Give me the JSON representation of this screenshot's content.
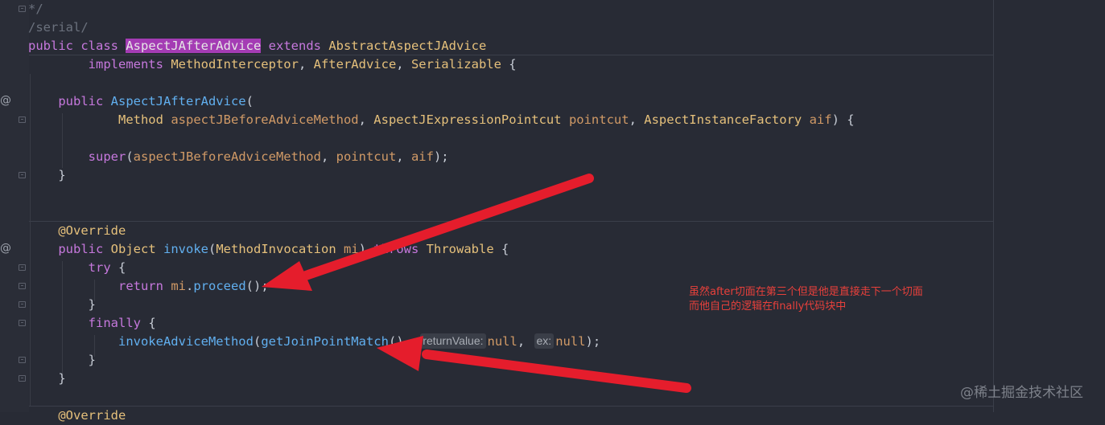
{
  "editor": {
    "lines": [
      {
        "tokens": [
          {
            "t": "*/",
            "c": "cm"
          }
        ]
      },
      {
        "tokens": [
          {
            "t": "/serial/",
            "c": "cm"
          }
        ]
      },
      {
        "tokens": [
          {
            "t": "public class ",
            "c": "kw"
          },
          {
            "t": "AspectJAfterAdvice",
            "c": "hl"
          },
          {
            "t": " "
          },
          {
            "t": "extends ",
            "c": "kw"
          },
          {
            "t": "AbstractAspectJAdvice",
            "c": "ty"
          }
        ]
      },
      {
        "tokens": [
          {
            "t": "        "
          },
          {
            "t": "implements ",
            "c": "kw"
          },
          {
            "t": "MethodInterceptor",
            "c": "ty"
          },
          {
            "t": ", "
          },
          {
            "t": "AfterAdvice",
            "c": "ty"
          },
          {
            "t": ", "
          },
          {
            "t": "Serializable",
            "c": "ty"
          },
          {
            "t": " {"
          }
        ]
      },
      {
        "tokens": []
      },
      {
        "tokens": [
          {
            "t": "    "
          },
          {
            "t": "public ",
            "c": "kw"
          },
          {
            "t": "AspectJAfterAdvice",
            "c": "fn"
          },
          {
            "t": "("
          }
        ]
      },
      {
        "tokens": [
          {
            "t": "            "
          },
          {
            "t": "Method",
            "c": "ty"
          },
          {
            "t": " "
          },
          {
            "t": "aspectJBeforeAdviceMethod",
            "c": "pr"
          },
          {
            "t": ", "
          },
          {
            "t": "AspectJExpressionPointcut",
            "c": "ty"
          },
          {
            "t": " "
          },
          {
            "t": "pointcut",
            "c": "pr"
          },
          {
            "t": ", "
          },
          {
            "t": "AspectInstanceFactory",
            "c": "ty"
          },
          {
            "t": " "
          },
          {
            "t": "aif",
            "c": "pr"
          },
          {
            "t": ") {"
          }
        ]
      },
      {
        "tokens": []
      },
      {
        "tokens": [
          {
            "t": "        "
          },
          {
            "t": "super",
            "c": "kw"
          },
          {
            "t": "("
          },
          {
            "t": "aspectJBeforeAdviceMethod",
            "c": "pr"
          },
          {
            "t": ", "
          },
          {
            "t": "pointcut",
            "c": "pr"
          },
          {
            "t": ", "
          },
          {
            "t": "aif",
            "c": "pr"
          },
          {
            "t": ");"
          }
        ]
      },
      {
        "tokens": [
          {
            "t": "    }"
          }
        ]
      },
      {
        "tokens": []
      },
      {
        "tokens": []
      },
      {
        "tokens": [
          {
            "t": "    "
          },
          {
            "t": "@Override",
            "c": "an"
          }
        ]
      },
      {
        "tokens": [
          {
            "t": "    "
          },
          {
            "t": "public ",
            "c": "kw"
          },
          {
            "t": "Object",
            "c": "ty"
          },
          {
            "t": " "
          },
          {
            "t": "invoke",
            "c": "fn"
          },
          {
            "t": "("
          },
          {
            "t": "MethodInvocation",
            "c": "ty"
          },
          {
            "t": " "
          },
          {
            "t": "mi",
            "c": "pr"
          },
          {
            "t": ") "
          },
          {
            "t": "throws ",
            "c": "kw"
          },
          {
            "t": "Throwable",
            "c": "ty"
          },
          {
            "t": " {"
          }
        ]
      },
      {
        "tokens": [
          {
            "t": "        "
          },
          {
            "t": "try",
            "c": "kw"
          },
          {
            "t": " {"
          }
        ]
      },
      {
        "tokens": [
          {
            "t": "            "
          },
          {
            "t": "return ",
            "c": "kw"
          },
          {
            "t": "mi",
            "c": "pr"
          },
          {
            "t": "."
          },
          {
            "t": "proceed",
            "c": "fn"
          },
          {
            "t": "();"
          }
        ]
      },
      {
        "tokens": [
          {
            "t": "        }"
          }
        ]
      },
      {
        "tokens": [
          {
            "t": "        "
          },
          {
            "t": "finally",
            "c": "kw"
          },
          {
            "t": " {"
          }
        ]
      },
      {
        "tokens": [
          {
            "t": "            "
          },
          {
            "t": "invokeAdviceMethod",
            "c": "fn"
          },
          {
            "t": "("
          },
          {
            "t": "getJoinPointMatch",
            "c": "fn"
          },
          {
            "t": "(), "
          },
          {
            "t": "returnValue:",
            "c": "hint"
          },
          {
            "t": "null",
            "c": "nl"
          },
          {
            "t": ", "
          },
          {
            "t": "ex:",
            "c": "hint"
          },
          {
            "t": "null",
            "c": "nl"
          },
          {
            "t": ");"
          }
        ]
      },
      {
        "tokens": [
          {
            "t": "        }"
          }
        ]
      },
      {
        "tokens": [
          {
            "t": "    }"
          }
        ]
      },
      {
        "tokens": []
      },
      {
        "tokens": [
          {
            "t": "    "
          },
          {
            "t": "@Override",
            "c": "an"
          }
        ]
      }
    ],
    "gutter_markers": [
      {
        "line": 5,
        "symbol": "@"
      },
      {
        "line": 13,
        "symbol": "@"
      }
    ]
  },
  "annotation": {
    "note_line1": "虽然after切面在第三个但是他是直接走下一个切面",
    "note_line2": "而他自己的逻辑在finally代码块中",
    "arrow_color": "#e51d2c"
  },
  "watermark": "@稀土掘金技术社区"
}
